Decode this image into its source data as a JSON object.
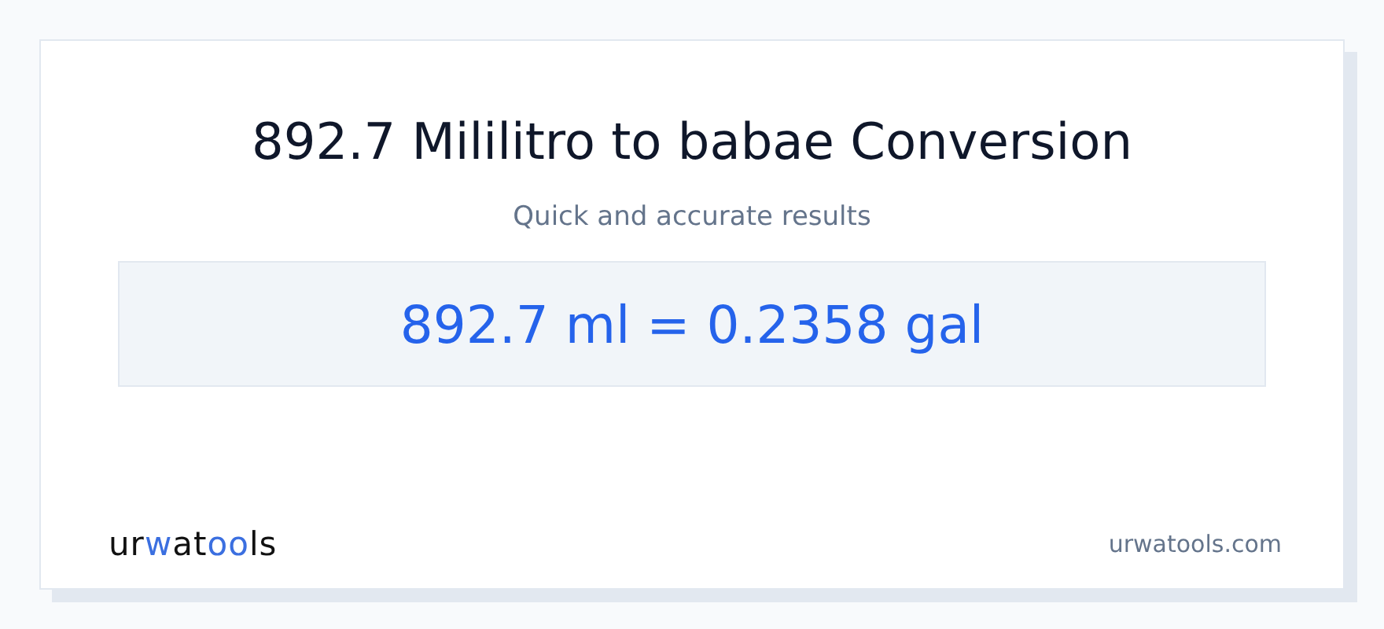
{
  "title": "892.7 Mililitro to babae Conversion",
  "subtitle": "Quick and accurate results",
  "result": "892.7 ml = 0.2358 gal",
  "logo": [
    {
      "text": "ur",
      "accent": false
    },
    {
      "text": "w",
      "accent": true
    },
    {
      "text": "at",
      "accent": false
    },
    {
      "text": "oo",
      "accent": true
    },
    {
      "text": "ls",
      "accent": false
    }
  ],
  "site": "urwatools.com"
}
